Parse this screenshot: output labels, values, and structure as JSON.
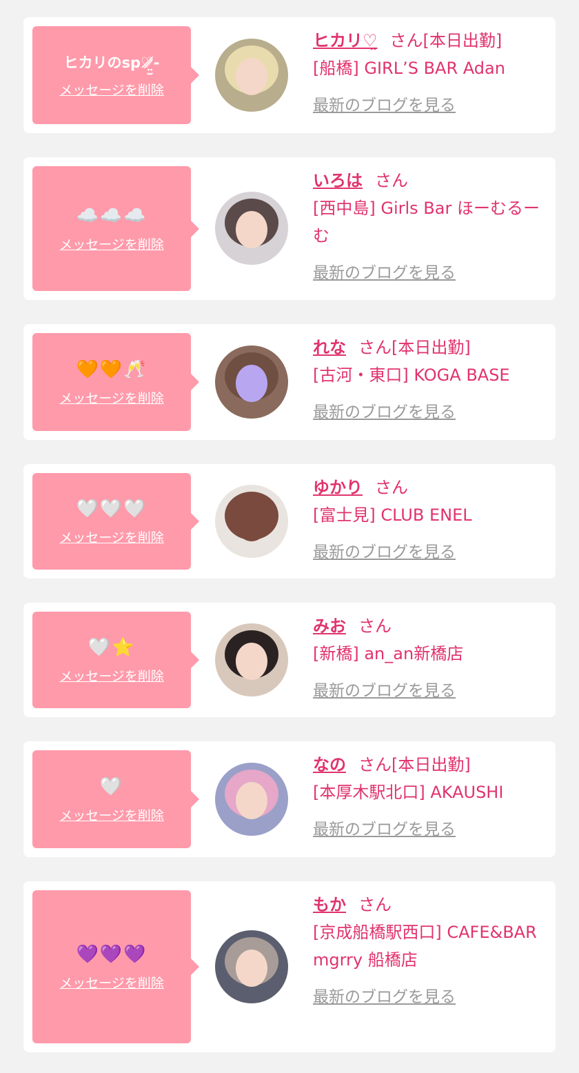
{
  "common": {
    "delete_label": "メッセージを削除",
    "blog_label": "最新のブログを見る",
    "san": "さん"
  },
  "colors": {
    "bubble": "#ff9aaa",
    "text_pink": "#e0336e",
    "link_gray": "#9a9a9a",
    "background": "#f2f2f2"
  },
  "favorites": [
    {
      "message": "ヒカリのsp♡̷̸̷̷̤̫-",
      "name": "ヒカリ♡̤",
      "status": "[本日出勤]",
      "shop": "[船橋] GIRL’S BAR Adan"
    },
    {
      "message": "☁️☁️☁️",
      "name": "いろは",
      "status": "",
      "shop": "[西中島] Girls Bar ほーむるーむ"
    },
    {
      "message": "🧡🧡🥂",
      "name": "れな",
      "status": "[本日出勤]",
      "shop": "[古河・東口] KOGA BASE"
    },
    {
      "message": "🤍🤍🤍",
      "name": "ゆかり",
      "status": "",
      "shop": "[富士見] CLUB ENEL"
    },
    {
      "message": "🤍⭐️",
      "name": "みお",
      "status": "",
      "shop": "[新橋] an_an新橋店"
    },
    {
      "message": "🤍",
      "name": "なの",
      "status": "[本日出勤]",
      "shop": "[本厚木駅北口] AKAUSHI"
    },
    {
      "message": "💜💜💜",
      "name": "もか",
      "status": "",
      "shop": "[京成船橋駅西口] CAFE&BAR mgrry 船橋店"
    }
  ]
}
